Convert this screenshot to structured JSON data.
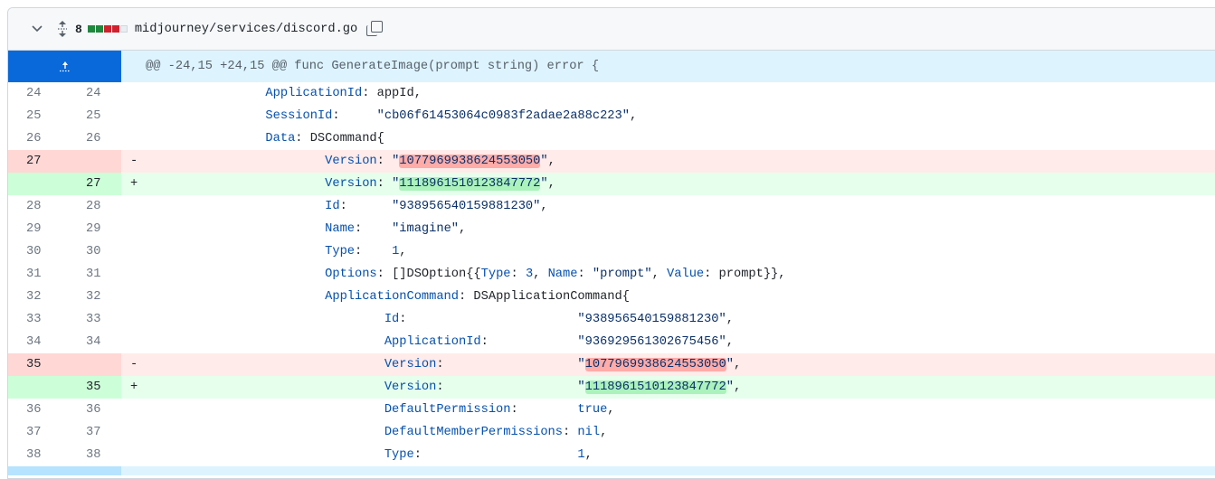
{
  "file": {
    "changes": "8",
    "path": "midjourney/services/discord.go",
    "diffstat": [
      "add",
      "add",
      "del",
      "del",
      "neutral"
    ],
    "colors": {
      "add": "#1f883d",
      "del": "#cf222e",
      "neutral": "#eaeef2"
    }
  },
  "hunk": {
    "header": "@@ -24,15 +24,15 @@ func GenerateImage(prompt string) error {"
  },
  "lines": [
    {
      "type": "ctx",
      "old": "24",
      "new": "24",
      "tokens": [
        [
          "p",
          "\t\t"
        ],
        [
          "k",
          "ApplicationId"
        ],
        [
          "p",
          ": appId,"
        ]
      ]
    },
    {
      "type": "ctx",
      "old": "25",
      "new": "25",
      "tokens": [
        [
          "p",
          "\t\t"
        ],
        [
          "k",
          "SessionId"
        ],
        [
          "p",
          ":     "
        ],
        [
          "s",
          "\"cb06f61453064c0983f2adae2a88c223\""
        ],
        [
          "p",
          ","
        ]
      ]
    },
    {
      "type": "ctx",
      "old": "26",
      "new": "26",
      "tokens": [
        [
          "p",
          "\t\t"
        ],
        [
          "k",
          "Data"
        ],
        [
          "p",
          ": DSCommand{"
        ]
      ]
    },
    {
      "type": "del",
      "old": "27",
      "new": "",
      "tokens": [
        [
          "p",
          "\t\t\t"
        ],
        [
          "k",
          "Version"
        ],
        [
          "p",
          ": "
        ],
        [
          "s",
          "\""
        ],
        [
          "hdel",
          "1077969938624553050"
        ],
        [
          "s",
          "\""
        ],
        [
          "p",
          ","
        ]
      ]
    },
    {
      "type": "add",
      "old": "",
      "new": "27",
      "tokens": [
        [
          "p",
          "\t\t\t"
        ],
        [
          "k",
          "Version"
        ],
        [
          "p",
          ": "
        ],
        [
          "s",
          "\""
        ],
        [
          "hadd",
          "1118961510123847772"
        ],
        [
          "s",
          "\""
        ],
        [
          "p",
          ","
        ]
      ]
    },
    {
      "type": "ctx",
      "old": "28",
      "new": "28",
      "tokens": [
        [
          "p",
          "\t\t\t"
        ],
        [
          "k",
          "Id"
        ],
        [
          "p",
          ":      "
        ],
        [
          "s",
          "\"938956540159881230\""
        ],
        [
          "p",
          ","
        ]
      ]
    },
    {
      "type": "ctx",
      "old": "29",
      "new": "29",
      "tokens": [
        [
          "p",
          "\t\t\t"
        ],
        [
          "k",
          "Name"
        ],
        [
          "p",
          ":    "
        ],
        [
          "s",
          "\"imagine\""
        ],
        [
          "p",
          ","
        ]
      ]
    },
    {
      "type": "ctx",
      "old": "30",
      "new": "30",
      "tokens": [
        [
          "p",
          "\t\t\t"
        ],
        [
          "k",
          "Type"
        ],
        [
          "p",
          ":    "
        ],
        [
          "c",
          "1"
        ],
        [
          "p",
          ","
        ]
      ]
    },
    {
      "type": "ctx",
      "old": "31",
      "new": "31",
      "tokens": [
        [
          "p",
          "\t\t\t"
        ],
        [
          "k",
          "Options"
        ],
        [
          "p",
          ": []DSOption{{"
        ],
        [
          "k",
          "Type"
        ],
        [
          "p",
          ": "
        ],
        [
          "c",
          "3"
        ],
        [
          "p",
          ", "
        ],
        [
          "k",
          "Name"
        ],
        [
          "p",
          ": "
        ],
        [
          "s",
          "\"prompt\""
        ],
        [
          "p",
          ", "
        ],
        [
          "k",
          "Value"
        ],
        [
          "p",
          ": prompt}},"
        ]
      ]
    },
    {
      "type": "ctx",
      "old": "32",
      "new": "32",
      "tokens": [
        [
          "p",
          "\t\t\t"
        ],
        [
          "k",
          "ApplicationCommand"
        ],
        [
          "p",
          ": DSApplicationCommand{"
        ]
      ]
    },
    {
      "type": "ctx",
      "old": "33",
      "new": "33",
      "tokens": [
        [
          "p",
          "\t\t\t\t"
        ],
        [
          "k",
          "Id"
        ],
        [
          "p",
          ":                       "
        ],
        [
          "s",
          "\"938956540159881230\""
        ],
        [
          "p",
          ","
        ]
      ]
    },
    {
      "type": "ctx",
      "old": "34",
      "new": "34",
      "tokens": [
        [
          "p",
          "\t\t\t\t"
        ],
        [
          "k",
          "ApplicationId"
        ],
        [
          "p",
          ":            "
        ],
        [
          "s",
          "\"936929561302675456\""
        ],
        [
          "p",
          ","
        ]
      ]
    },
    {
      "type": "del",
      "old": "35",
      "new": "",
      "tokens": [
        [
          "p",
          "\t\t\t\t"
        ],
        [
          "k",
          "Version"
        ],
        [
          "p",
          ":                  "
        ],
        [
          "s",
          "\""
        ],
        [
          "hdel",
          "1077969938624553050"
        ],
        [
          "s",
          "\""
        ],
        [
          "p",
          ","
        ]
      ]
    },
    {
      "type": "add",
      "old": "",
      "new": "35",
      "tokens": [
        [
          "p",
          "\t\t\t\t"
        ],
        [
          "k",
          "Version"
        ],
        [
          "p",
          ":                  "
        ],
        [
          "s",
          "\""
        ],
        [
          "hadd",
          "1118961510123847772"
        ],
        [
          "s",
          "\""
        ],
        [
          "p",
          ","
        ]
      ]
    },
    {
      "type": "ctx",
      "old": "36",
      "new": "36",
      "tokens": [
        [
          "p",
          "\t\t\t\t"
        ],
        [
          "k",
          "DefaultPermission"
        ],
        [
          "p",
          ":        "
        ],
        [
          "c",
          "true"
        ],
        [
          "p",
          ","
        ]
      ]
    },
    {
      "type": "ctx",
      "old": "37",
      "new": "37",
      "tokens": [
        [
          "p",
          "\t\t\t\t"
        ],
        [
          "k",
          "DefaultMemberPermissions"
        ],
        [
          "p",
          ": "
        ],
        [
          "c",
          "nil"
        ],
        [
          "p",
          ","
        ]
      ]
    },
    {
      "type": "ctx",
      "old": "38",
      "new": "38",
      "tokens": [
        [
          "p",
          "\t\t\t\t"
        ],
        [
          "k",
          "Type"
        ],
        [
          "p",
          ":                     "
        ],
        [
          "c",
          "1"
        ],
        [
          "p",
          ","
        ]
      ]
    }
  ],
  "markers": {
    "del": "-",
    "add": "+",
    "ctx": ""
  }
}
